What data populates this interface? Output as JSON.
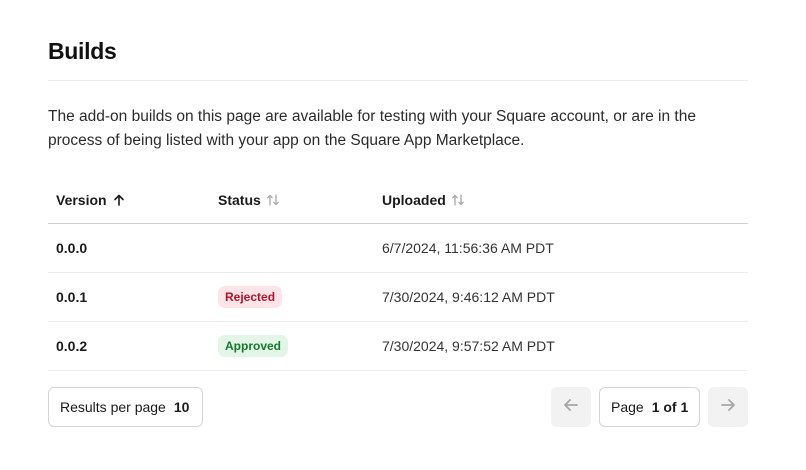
{
  "page": {
    "title": "Builds",
    "description": "The add-on builds on this page are available for testing with your Square account, or are in the process of being listed with your app on the Square App Marketplace."
  },
  "table": {
    "columns": [
      {
        "label": "Version",
        "sort": "ascending",
        "icon": "arrow-up-icon"
      },
      {
        "label": "Status",
        "sort": "none",
        "icon": "sort-icon"
      },
      {
        "label": "Uploaded",
        "sort": "none",
        "icon": "sort-icon"
      }
    ],
    "rows": [
      {
        "version": "0.0.0",
        "status": "",
        "uploaded": "6/7/2024, 11:56:36 AM PDT"
      },
      {
        "version": "0.0.1",
        "status": "Rejected",
        "uploaded": "7/30/2024, 9:46:12 AM PDT"
      },
      {
        "version": "0.0.2",
        "status": "Approved",
        "uploaded": "7/30/2024, 9:57:52 AM PDT"
      }
    ]
  },
  "pagination": {
    "results_label": "Results per page",
    "results_value": "10",
    "page_label": "Page",
    "page_value": "1 of 1",
    "prev_icon": "arrow-left-icon",
    "next_icon": "arrow-right-icon"
  },
  "colors": {
    "rejected_bg": "#fde4e6",
    "rejected_text": "#b3132a",
    "approved_bg": "#e3f5e6",
    "approved_text": "#117a2b"
  }
}
